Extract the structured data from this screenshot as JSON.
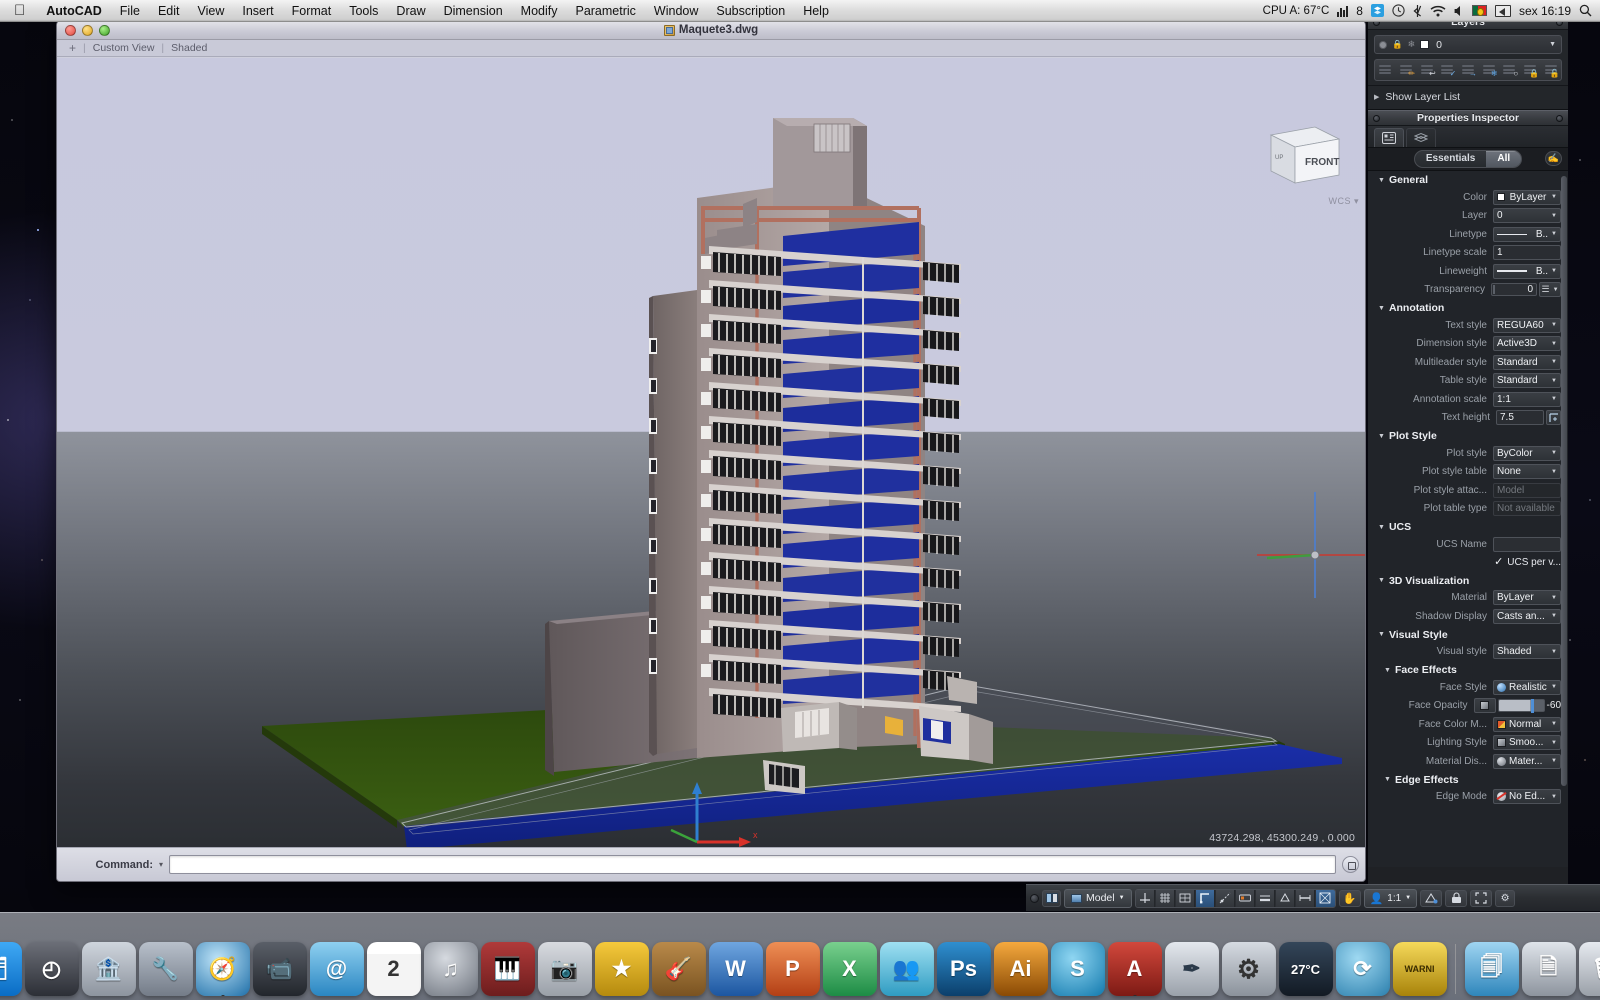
{
  "menubar": {
    "apple_icon": "apple-logo-icon",
    "app_name": "AutoCAD",
    "items": [
      "File",
      "Edit",
      "View",
      "Insert",
      "Format",
      "Tools",
      "Draw",
      "Dimension",
      "Modify",
      "Parametric",
      "Window",
      "Subscription",
      "Help"
    ],
    "status": {
      "cpu": "CPU A: 67°C",
      "activity_count": "8",
      "clock_icon": "clock-icon",
      "bluetooth_icon": "bluetooth-icon",
      "wifi_icon": "wifi-icon",
      "volume_icon": "volume-icon",
      "flag_icon": "portugal-flag-icon",
      "timemachine_icon": "eject-display-icon",
      "datetime": "sex 16:19",
      "spotlight_icon": "search-icon"
    }
  },
  "window": {
    "title": "Maquete3.dwg",
    "doc_icon": "dwg-file-icon",
    "traffic": {
      "close": "close-button",
      "minimize": "minimize-button",
      "zoom": "zoom-button"
    },
    "viewport_bar": {
      "plus": "+",
      "view_label": "Custom View",
      "visual_style_label": "Shaded"
    },
    "viewcube": {
      "front_face": "FRONT",
      "up_label": "UP",
      "wcs_label": "WCS"
    },
    "coordinates": "43724.298,  45300.249  , 0.000",
    "command": {
      "label": "Command:",
      "value": "",
      "placeholder": "",
      "history_icon": "history-icon"
    }
  },
  "layers_palette": {
    "title": "Layers",
    "current_layer": "0",
    "row_icons": [
      "lightbulb-icon",
      "lock-icon",
      "freeze-icon",
      "color-swatch-icon",
      "chevron-down-icon"
    ],
    "tools": [
      {
        "name": "layer-properties-manager",
        "badge": ""
      },
      {
        "name": "layer-match",
        "badge": "✎"
      },
      {
        "name": "layer-previous",
        "badge": ""
      },
      {
        "name": "layer-make-current",
        "badge": "✓"
      },
      {
        "name": "layer-change-to-current",
        "badge": "→"
      },
      {
        "name": "layer-freeze",
        "badge": "❄"
      },
      {
        "name": "layer-off",
        "badge": "○"
      },
      {
        "name": "layer-lock",
        "badge": "▤"
      },
      {
        "name": "layer-unlock",
        "badge": "▣"
      }
    ],
    "show_layer_list": "Show Layer List"
  },
  "properties_inspector": {
    "title": "Properties Inspector",
    "tabs": [
      {
        "name": "object-properties-tab",
        "icon": "grid-properties-icon",
        "active": true
      },
      {
        "name": "layer-properties-tab",
        "icon": "layers-stack-icon",
        "active": false
      }
    ],
    "filter": {
      "options": [
        "Essentials",
        "All"
      ],
      "selected": "All"
    },
    "eyedropper_icon": "eyedropper-icon",
    "groups": [
      {
        "label": "General",
        "expanded": true,
        "rows": [
          {
            "label": "Color",
            "value": "ByLayer",
            "kind": "swatch-dropdown"
          },
          {
            "label": "Layer",
            "value": "0",
            "kind": "dropdown"
          },
          {
            "label": "Linetype",
            "value": "B..",
            "kind": "linetype-dropdown"
          },
          {
            "label": "Linetype scale",
            "value": "1",
            "kind": "text"
          },
          {
            "label": "Lineweight",
            "value": "B..",
            "kind": "lineweight-dropdown"
          },
          {
            "label": "Transparency",
            "value": "0",
            "kind": "transparency"
          }
        ]
      },
      {
        "label": "Annotation",
        "expanded": true,
        "rows": [
          {
            "label": "Text style",
            "value": "REGUA60",
            "kind": "dropdown"
          },
          {
            "label": "Dimension style",
            "value": "Active3D",
            "kind": "dropdown"
          },
          {
            "label": "Multileader style",
            "value": "Standard",
            "kind": "dropdown"
          },
          {
            "label": "Table style",
            "value": "Standard",
            "kind": "dropdown"
          },
          {
            "label": "Annotation scale",
            "value": "1:1",
            "kind": "dropdown"
          },
          {
            "label": "Text height",
            "value": "7.5",
            "kind": "text-with-button"
          }
        ]
      },
      {
        "label": "Plot Style",
        "expanded": true,
        "rows": [
          {
            "label": "Plot style",
            "value": "ByColor",
            "kind": "dropdown"
          },
          {
            "label": "Plot style table",
            "value": "None",
            "kind": "dropdown"
          },
          {
            "label": "Plot style attac...",
            "value": "Model",
            "kind": "disabled"
          },
          {
            "label": "Plot table type",
            "value": "Not available",
            "kind": "disabled"
          }
        ]
      },
      {
        "label": "UCS",
        "expanded": true,
        "rows": [
          {
            "label": "UCS Name",
            "value": "",
            "kind": "blank"
          },
          {
            "label": "UCS per v...",
            "value": "",
            "kind": "checkbox",
            "checked": true
          }
        ]
      },
      {
        "label": "3D Visualization",
        "expanded": true,
        "rows": [
          {
            "label": "Material",
            "value": "ByLayer",
            "kind": "dropdown"
          },
          {
            "label": "Shadow Display",
            "value": "Casts an...",
            "kind": "dropdown"
          }
        ]
      },
      {
        "label": "Visual Style",
        "expanded": true,
        "rows": [
          {
            "label": "Visual style",
            "value": "Shaded",
            "kind": "dropdown"
          }
        ]
      },
      {
        "label": "Face Effects",
        "expanded": true,
        "sub": true,
        "rows": [
          {
            "label": "Face Style",
            "value": "Realistic",
            "kind": "sphere-dropdown"
          },
          {
            "label": "Face Opacity",
            "value": "-60",
            "kind": "opacity-slider"
          },
          {
            "label": "Face Color M...",
            "value": "Normal",
            "kind": "colormode-dropdown"
          },
          {
            "label": "Lighting Style",
            "value": "Smoo...",
            "kind": "grid-dropdown"
          },
          {
            "label": "Material Dis...",
            "value": "Mater...",
            "kind": "material-dropdown"
          }
        ]
      },
      {
        "label": "Edge Effects",
        "expanded": true,
        "sub": true,
        "rows": [
          {
            "label": "Edge Mode",
            "value": "No Ed...",
            "kind": "noedge-dropdown"
          }
        ]
      }
    ]
  },
  "statusbar": {
    "model_label": "Model",
    "model_icon": "model-space-icon",
    "toggles": [
      {
        "name": "ortho-toggle",
        "icon": "ortho-icon",
        "on": false
      },
      {
        "name": "grid-toggle",
        "icon": "grid-icon",
        "on": false
      },
      {
        "name": "snap-toggle",
        "icon": "snap-grid-icon",
        "on": false
      },
      {
        "name": "osnap-toggle",
        "icon": "osnap-icon",
        "on": true
      },
      {
        "name": "otrack-toggle",
        "icon": "polar-track-icon",
        "on": false
      },
      {
        "name": "dyninput-toggle",
        "icon": "dynamic-input-icon",
        "on": false
      },
      {
        "name": "lineweight-toggle",
        "icon": "lineweight-show-icon",
        "on": false
      },
      {
        "name": "transparency-toggle",
        "icon": "transparency-icon",
        "on": false
      },
      {
        "name": "annoscale-toggle",
        "icon": "annotation-scale-icon",
        "on": false
      },
      {
        "name": "visualstyle-toggle",
        "icon": "visual-style-icon",
        "on": true
      }
    ],
    "pan_icon": "hand-pan-icon",
    "scale_icon": "annotation-person-icon",
    "scale_value": "1:1",
    "annomonitor_icon": "anno-monitor-icon",
    "lock_icon": "lock-toolbar-icon",
    "fullscreen_icon": "fullscreen-icon",
    "options_icon": "options-gear-icon"
  },
  "dock": {
    "items": [
      {
        "name": "finder",
        "label": "🗂",
        "color1": "#3fa9f5",
        "color2": "#0a6cc4",
        "running": true
      },
      {
        "name": "launchpad",
        "label": "◴",
        "color1": "#6c6f78",
        "color2": "#2c2f36",
        "running": false
      },
      {
        "name": "app-bank",
        "label": "🏦",
        "color1": "#cfd5dd",
        "color2": "#8d949e",
        "running": false
      },
      {
        "name": "dash-tool",
        "label": "🔧",
        "color1": "#b8c0cb",
        "color2": "#747c88",
        "running": false
      },
      {
        "name": "safari",
        "label": "🧭",
        "color1": "#7cc3ea",
        "color2": "#1f6fa8",
        "running": true
      },
      {
        "name": "photobooth",
        "label": "📹",
        "color1": "#5a5f68",
        "color2": "#22262c",
        "running": false
      },
      {
        "name": "mail",
        "label": "@",
        "color1": "#8fd0f0",
        "color2": "#2a86c2",
        "running": false
      },
      {
        "name": "calendar",
        "label": "2",
        "color1": "#ffffff",
        "color2": "#dddddd",
        "running": false
      },
      {
        "name": "itunes",
        "label": "♫",
        "color1": "#b1b6bf",
        "color2": "#6d737d",
        "running": false
      },
      {
        "name": "garageband-amp",
        "label": "🎹",
        "color1": "#b03a3a",
        "color2": "#6d1d1d",
        "running": false
      },
      {
        "name": "iphoto",
        "label": "📷",
        "color1": "#d8dbe0",
        "color2": "#9aa0a8",
        "running": false
      },
      {
        "name": "imovie",
        "label": "★",
        "color1": "#f5c93c",
        "color2": "#b58a0e",
        "running": false
      },
      {
        "name": "guitar-app",
        "label": "🎸",
        "color1": "#b98a4a",
        "color2": "#7a5321",
        "running": false
      },
      {
        "name": "word",
        "label": "W",
        "color1": "#4f8ed6",
        "color2": "#1c56a0",
        "running": false
      },
      {
        "name": "powerpoint",
        "label": "P",
        "color1": "#e07a4a",
        "color2": "#b33f15",
        "running": false
      },
      {
        "name": "excel",
        "label": "X",
        "color1": "#63c07a",
        "color2": "#1d8c45",
        "running": false
      },
      {
        "name": "messenger",
        "label": "👥",
        "color1": "#7fd0e8",
        "color2": "#2f9cc2",
        "running": false
      },
      {
        "name": "photoshop",
        "label": "Ps",
        "color1": "#2f8fd0",
        "color2": "#0b3f6b",
        "running": false
      },
      {
        "name": "illustrator",
        "label": "Ai",
        "color1": "#f5901e",
        "color2": "#8a4a04",
        "running": false
      },
      {
        "name": "skype",
        "label": "S",
        "color1": "#58b8e8",
        "color2": "#1279ad",
        "running": false
      },
      {
        "name": "autocad",
        "label": "A",
        "color1": "#c1362d",
        "color2": "#7d1a14",
        "running": true
      },
      {
        "name": "autocad-ws",
        "label": "✒",
        "color1": "#d9dde3",
        "color2": "#9aa1aa",
        "running": false
      },
      {
        "name": "system-prefs",
        "label": "⚙",
        "color1": "#c9ced6",
        "color2": "#8b929b",
        "running": false
      },
      {
        "name": "weather-widget",
        "label": "27°C",
        "color1": "#2b3a4a",
        "color2": "#121a24",
        "running": false
      },
      {
        "name": "transmission",
        "label": "⟳",
        "color1": "#7fc6e8",
        "color2": "#2b7fad",
        "running": false
      },
      {
        "name": "alarm-widget",
        "label": "WARNI",
        "color1": "#f0c93a",
        "color2": "#a8830a",
        "running": false
      }
    ],
    "right_items": [
      {
        "name": "downloads-stack",
        "label": "🗐",
        "color1": "#7fc3e8",
        "color2": "#2f86bb",
        "running": false
      },
      {
        "name": "documents-stack",
        "label": "🗎",
        "color1": "#cfd5dd",
        "color2": "#8d949e",
        "running": false
      },
      {
        "name": "trash",
        "label": "🗑",
        "color1": "#d6dae0",
        "color2": "#9aa0a8",
        "running": false
      }
    ]
  }
}
